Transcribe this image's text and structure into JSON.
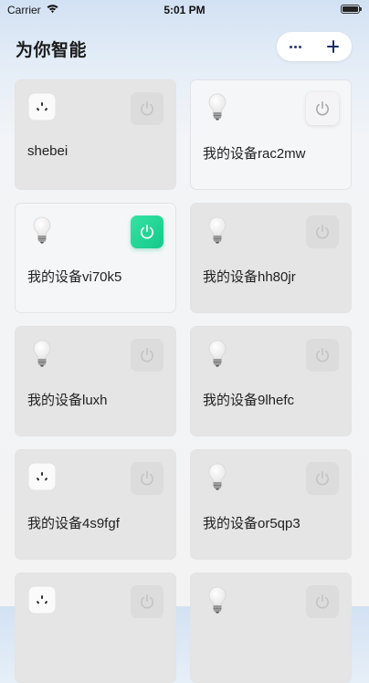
{
  "status_bar": {
    "carrier": "Carrier",
    "time": "5:01 PM"
  },
  "header": {
    "title": "为你智能"
  },
  "devices": [
    {
      "name": "shebei",
      "icon": "socket-icon",
      "power": "off"
    },
    {
      "name": "我的设备rac2mw",
      "icon": "bulb-icon",
      "power": "off"
    },
    {
      "name": "我的设备vi70k5",
      "icon": "bulb-icon",
      "power": "on"
    },
    {
      "name": "我的设备hh80jr",
      "icon": "bulb-icon",
      "power": "off"
    },
    {
      "name": "我的设备luxh",
      "icon": "bulb-icon",
      "power": "off"
    },
    {
      "name": "我的设备9lhefc",
      "icon": "bulb-icon",
      "power": "off"
    },
    {
      "name": "我的设备4s9fgf",
      "icon": "socket-icon",
      "power": "off"
    },
    {
      "name": "我的设备or5qp3",
      "icon": "bulb-icon",
      "power": "off"
    },
    {
      "name": "",
      "icon": "socket-icon",
      "power": "off"
    },
    {
      "name": "",
      "icon": "bulb-icon",
      "power": "off"
    }
  ],
  "colors": {
    "accent": "#1fd496",
    "card_off": "#e5e5e5",
    "card_on": "#f5f6f8"
  }
}
